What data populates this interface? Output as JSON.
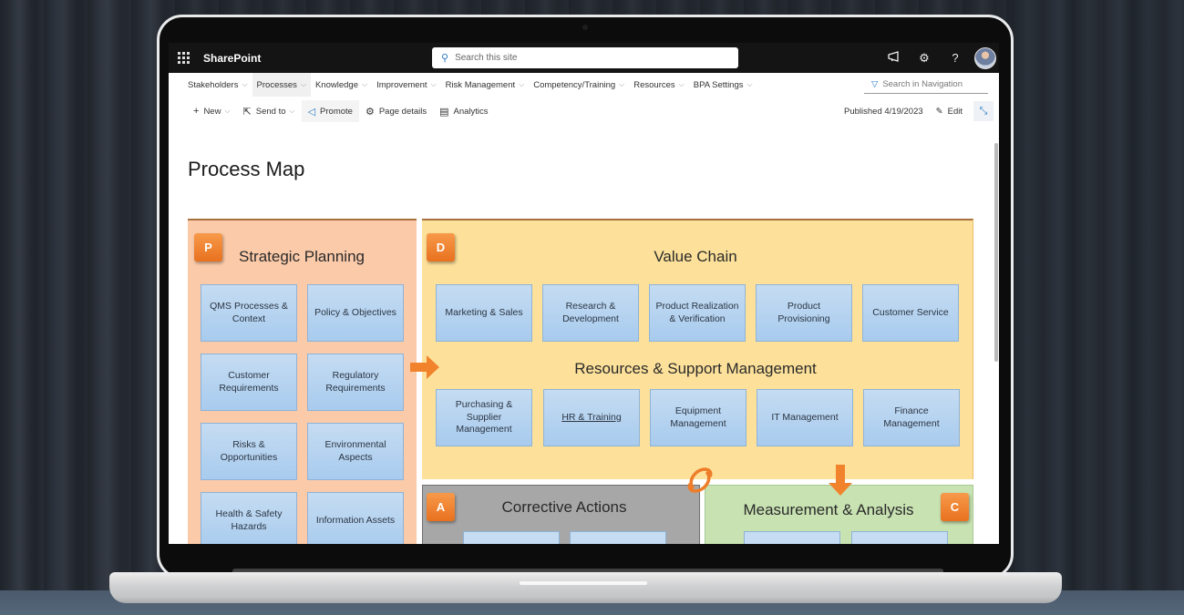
{
  "suite_bar": {
    "app_name": "SharePoint",
    "search_placeholder": "Search this site",
    "icons": [
      "megaphone-icon",
      "gear-icon",
      "help-icon",
      "avatar"
    ]
  },
  "hub_nav": {
    "items": [
      {
        "label": "Stakeholders",
        "active": false
      },
      {
        "label": "Processes",
        "active": true
      },
      {
        "label": "Knowledge",
        "active": false
      },
      {
        "label": "Improvement",
        "active": false
      },
      {
        "label": "Risk Management",
        "active": false
      },
      {
        "label": "Competency/Training",
        "active": false
      },
      {
        "label": "Resources",
        "active": false
      },
      {
        "label": "BPA Settings",
        "active": false
      }
    ],
    "search_placeholder": "Search in Navigation"
  },
  "command_bar": {
    "new_label": "New",
    "send_to_label": "Send to",
    "promote_label": "Promote",
    "page_details_label": "Page details",
    "analytics_label": "Analytics",
    "published_label": "Published 4/19/2023",
    "edit_label": "Edit"
  },
  "page": {
    "title": "Process Map"
  },
  "process_map": {
    "plan": {
      "badge": "P",
      "title": "Strategic Planning",
      "boxes": [
        "QMS Processes & Context",
        "Policy & Objectives",
        "Customer Requirements",
        "Regulatory Requirements",
        "Risks & Opportunities",
        "Environmental Aspects",
        "Health & Safety Hazards",
        "Information Assets"
      ]
    },
    "do": {
      "badge": "D",
      "value_chain_title": "Value Chain",
      "value_chain_boxes": [
        "Marketing & Sales",
        "Research & Development",
        "Product Realization & Verification",
        "Product Provisioning",
        "Customer Service"
      ],
      "support_title": "Resources & Support Management",
      "support_boxes": [
        "Purchasing & Supplier Management",
        "HR & Training",
        "Equipment Management",
        "IT Management",
        "Finance Management"
      ],
      "linked_box": "HR & Training"
    },
    "act": {
      "badge": "A",
      "title": "Corrective Actions"
    },
    "check": {
      "badge": "C",
      "title": "Measurement & Analysis"
    },
    "colors": {
      "plan": "#fbcaa9",
      "do": "#fde19a",
      "act": "#a7a7a7",
      "check": "#c8e2b2",
      "badge": "#ee7d2a",
      "box": "#b6d3f0"
    }
  }
}
